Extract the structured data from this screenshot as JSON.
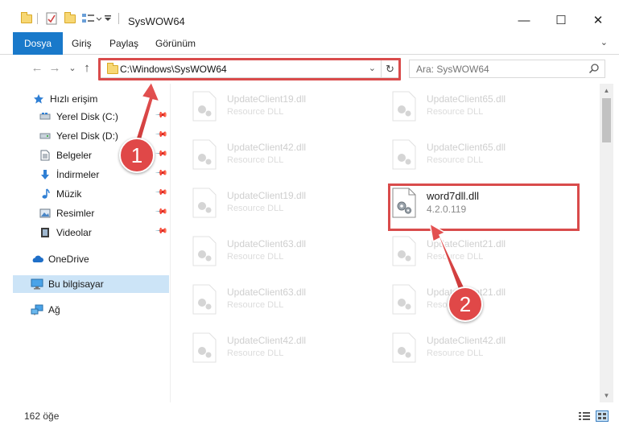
{
  "window": {
    "title": "SysWOW64",
    "minimize": "—",
    "maximize": "☐",
    "close": "✕"
  },
  "ribbon": {
    "tabs": [
      {
        "label": "Dosya",
        "active": true
      },
      {
        "label": "Giriş"
      },
      {
        "label": "Paylaş"
      },
      {
        "label": "Görünüm"
      }
    ],
    "expander": "⌄"
  },
  "nav": {
    "back": "←",
    "forward": "→",
    "recent": "⌄",
    "up": "↑",
    "address": "C:\\Windows\\SysWOW64",
    "address_dropdown": "⌄",
    "refresh": "↻",
    "search_placeholder": "Ara: SysWOW64"
  },
  "sidebar": {
    "items": [
      {
        "label": "Hızlı erişim",
        "icon": "star-icon",
        "pinned": false
      },
      {
        "label": "Yerel Disk (C:)",
        "icon": "drive-icon",
        "pinned": true
      },
      {
        "label": "Yerel Disk (D:)",
        "icon": "drive-icon",
        "pinned": true
      },
      {
        "label": "Belgeler",
        "icon": "document-icon",
        "pinned": true
      },
      {
        "label": "İndirmeler",
        "icon": "download-icon",
        "pinned": true
      },
      {
        "label": "Müzik",
        "icon": "music-icon",
        "pinned": true
      },
      {
        "label": "Resimler",
        "icon": "pictures-icon",
        "pinned": true
      },
      {
        "label": "Videolar",
        "icon": "video-icon",
        "pinned": true
      },
      {
        "label": "OneDrive",
        "icon": "cloud-icon",
        "pinned": false
      },
      {
        "label": "Bu bilgisayar",
        "icon": "computer-icon",
        "pinned": false,
        "selected": true
      },
      {
        "label": "Ağ",
        "icon": "network-icon",
        "pinned": false
      }
    ]
  },
  "files": {
    "left": [
      {
        "name": "UpdateClient19.dll",
        "sub": "Resource DLL"
      },
      {
        "name": "UpdateClient42.dll",
        "sub": "Resource DLL"
      },
      {
        "name": "UpdateClient19.dll",
        "sub": "Resource DLL"
      },
      {
        "name": "UpdateClient63.dll",
        "sub": "Resource DLL"
      },
      {
        "name": "UpdateClient63.dll",
        "sub": "Resource DLL"
      },
      {
        "name": "UpdateClient42.dll",
        "sub": "Resource DLL"
      }
    ],
    "right": [
      {
        "name": "UpdateClient65.dll",
        "sub": "Resource DLL"
      },
      {
        "name": "UpdateClient65.dll",
        "sub": "Resource DLL"
      },
      {
        "name": "word7dll.dll",
        "sub": "4.2.0.119",
        "focus": true
      },
      {
        "name": "UpdateClient21.dll",
        "sub": "Resource DLL"
      },
      {
        "name": "UpdateClient21.dll",
        "sub": "Resource DLL"
      },
      {
        "name": "UpdateClient42.dll",
        "sub": "Resource DLL"
      }
    ]
  },
  "status": {
    "count": "162 öğe"
  },
  "annotations": {
    "badge1": "1",
    "badge2": "2",
    "color": "#e04848"
  },
  "colors": {
    "accent": "#1979ca",
    "selection": "#cce4f7",
    "highlight_box": "#d94b4b"
  }
}
